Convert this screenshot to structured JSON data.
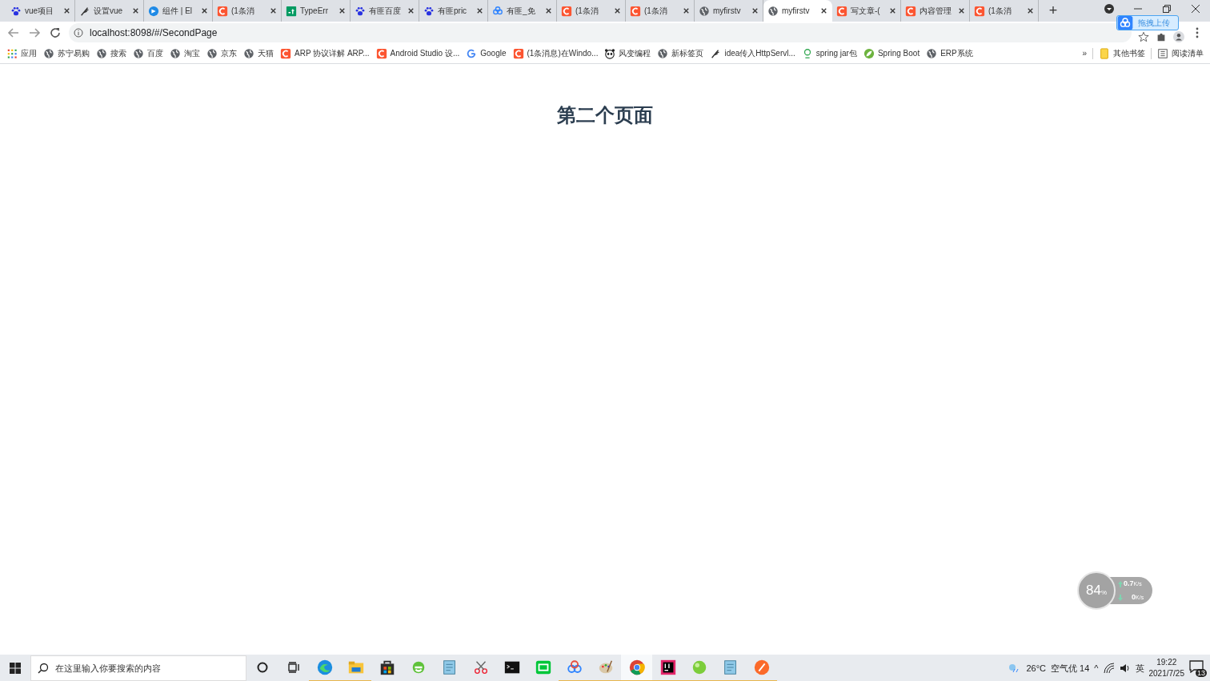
{
  "tabs": [
    {
      "title": "vue项目",
      "selected": false
    },
    {
      "title": "设置vue",
      "selected": false
    },
    {
      "title": "组件 | El",
      "selected": false
    },
    {
      "title": "(1条消",
      "selected": false
    },
    {
      "title": "TypeErr",
      "selected": false
    },
    {
      "title": "有匪百度",
      "selected": false
    },
    {
      "title": "有匪pric",
      "selected": false
    },
    {
      "title": "有匪_免",
      "selected": false
    },
    {
      "title": "(1条消",
      "selected": false
    },
    {
      "title": "(1条消",
      "selected": false
    },
    {
      "title": "myfirstv",
      "selected": false
    },
    {
      "title": "myfirstv",
      "selected": true
    },
    {
      "title": "写文章-(",
      "selected": false
    },
    {
      "title": "内容管理",
      "selected": false
    },
    {
      "title": "(1条消",
      "selected": false
    }
  ],
  "new_tab": "+",
  "upload_badge": "拖拽上传",
  "address_bar": {
    "url": "localhost:8098/#/SecondPage"
  },
  "bookmarks": [
    "应用",
    "苏宁易购",
    "搜索",
    "百度",
    "淘宝",
    "京东",
    "天猫",
    "ARP 协议详解 ARP...",
    "Android Studio 设...",
    "Google",
    "(1条消息)在Windo...",
    "风变编程",
    "新标签页",
    "idea传入HttpServl...",
    "spring jar包",
    "Spring Boot",
    "ERP系统"
  ],
  "bookmarks_more": "»",
  "other_bookmarks": "其他书签",
  "reading_list": "阅读清单",
  "page": {
    "heading": "第二个页面"
  },
  "speed_widget": {
    "percent": "84",
    "percent_unit": "%",
    "upload": "0.7",
    "upload_unit": "K/s",
    "download": "0",
    "download_unit": "K/s"
  },
  "taskbar": {
    "search": {
      "placeholder": "在这里输入你要搜索的内容"
    },
    "apps": [
      {
        "running": true,
        "selected": false
      },
      {
        "running": true,
        "selected": false
      },
      {
        "running": false,
        "selected": false
      },
      {
        "running": false,
        "selected": false
      },
      {
        "running": false,
        "selected": false
      },
      {
        "running": false,
        "selected": false
      },
      {
        "running": false,
        "selected": false
      },
      {
        "running": false,
        "selected": false
      },
      {
        "running": true,
        "selected": false
      },
      {
        "running": true,
        "selected": false
      },
      {
        "running": true,
        "selected": true
      },
      {
        "running": true,
        "selected": false
      },
      {
        "running": true,
        "selected": false
      },
      {
        "running": true,
        "selected": false
      },
      {
        "running": true,
        "selected": false
      }
    ],
    "weather": "26°C",
    "air": "空气优 14",
    "tray_caret": "^",
    "ime": "英",
    "time": "19:22",
    "date": "2021/7/25",
    "notifications": "13"
  }
}
